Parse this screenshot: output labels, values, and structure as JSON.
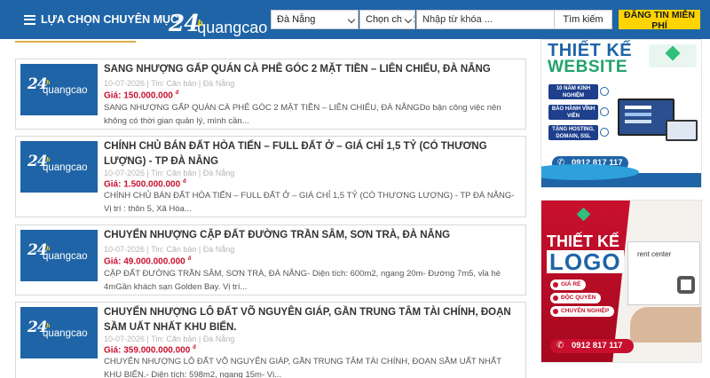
{
  "header": {
    "menu_label": "LỰA CHỌN CHUYÊN MỤC",
    "logo_number": "24",
    "logo_superscript": "h",
    "logo_text": "quangcao",
    "city_select": "Đà Nẵng",
    "category_select": "Chọn chuyên",
    "search_placeholder": "Nhập từ khóa ...",
    "search_button": "Tìm kiếm",
    "post_button": "ĐĂNG TIN MIỄN PHÍ",
    "brand_color": "#1f64a6",
    "accent_color": "#ffd400"
  },
  "listings": [
    {
      "title": "SANG NHƯỢNG GẤP QUÁN CÀ PHÊ GÓC 2 MẶT TIỀN – LIÊN CHIỂU, ĐÀ NẴNG",
      "meta": "10-07-2026 | Tin: Căn bản | Đà Nẵng",
      "price_label": "Giá:",
      "price": "150.000.000",
      "currency": "đ",
      "description": "SANG NHƯỢNG GẤP QUÁN CÀ PHÊ GÓC 2 MẶT TIỀN – LIÊN CHIỂU, ĐÀ NẴNGDo bận công việc nên không có thời gian quản lý, mình cần..."
    },
    {
      "title": "CHÍNH CHỦ BÁN ĐẤT HÒA TIẾN – FULL ĐẤT Ở – GIÁ CHỈ 1,5 TỶ (CÓ THƯƠNG LƯỢNG) - TP ĐÀ NẴNG",
      "meta": "10-07-2026 | Tin: Căn bản | Đà Nẵng",
      "price_label": "Giá:",
      "price": "1.500.000.000",
      "currency": "đ",
      "description": "CHÍNH CHỦ BÁN ĐẤT HÒA TIẾN – FULL ĐẤT Ở – GIÁ CHỈ 1,5 TỶ (CÓ THƯƠNG LƯỢNG) - TP ĐÀ NẴNG- Vị trí : thôn 5, Xã Hòa..."
    },
    {
      "title": "CHUYỂN NHƯỢNG CẶP ĐẤT ĐƯỜNG TRẦN SÂM, SƠN TRÀ, ĐÀ NẴNG",
      "meta": "10-07-2026 | Tin: Căn bản | Đà Nẵng",
      "price_label": "Giá:",
      "price": "49.000.000.000",
      "currency": "đ",
      "description": "CẶP ĐẤT ĐƯỜNG TRẦN SÂM, SƠN TRÀ, ĐÀ NẴNG- Diện tích: 600m2, ngang 20m- Đường 7m5, vỉa hè 4mGần khách sạn Golden Bay. Vị trí..."
    },
    {
      "title": "CHUYỂN NHƯỢNG LÔ ĐẤT VÕ NGUYÊN GIÁP, GẦN TRUNG TÂM TÀI CHÍNH, ĐOẠN SẦM UẤT NHẤT KHU BIỂN.",
      "meta": "10-07-2026 | Tin: Căn bản | Đà Nẵng",
      "price_label": "Giá:",
      "price": "359.000.000.000",
      "currency": "đ",
      "description": "CHUYỂN NHƯỢNG LÔ ĐẤT VÕ NGUYÊN GIÁP, GẦN TRUNG TÂM TÀI CHÍNH, ĐOẠN SẦM UẤT NHẤT KHU BIỂN.- Diện tích: 598m2, ngang 15m- Vị..."
    }
  ],
  "thumbnail": {
    "number": "24",
    "superscript": "h",
    "text": "quangcao"
  },
  "banner_website": {
    "title_line1": "THIẾT KẾ",
    "title_line2": "WEBSITE",
    "features": [
      "10 NĂM KINH NGHIỆM",
      "BẢO HÀNH VĨNH VIỄN",
      "TẶNG HOSTING, DOMAIN, SSL"
    ],
    "phone": "0912 817 117"
  },
  "banner_logo": {
    "title_line1": "THIẾT KẾ",
    "title_line2": "LOGO",
    "features": [
      "GIÁ RẺ",
      "ĐỘC QUYỀN",
      "CHUYÊN NGHIỆP"
    ],
    "card_text": "rent center",
    "phone": "0912 817 117"
  }
}
